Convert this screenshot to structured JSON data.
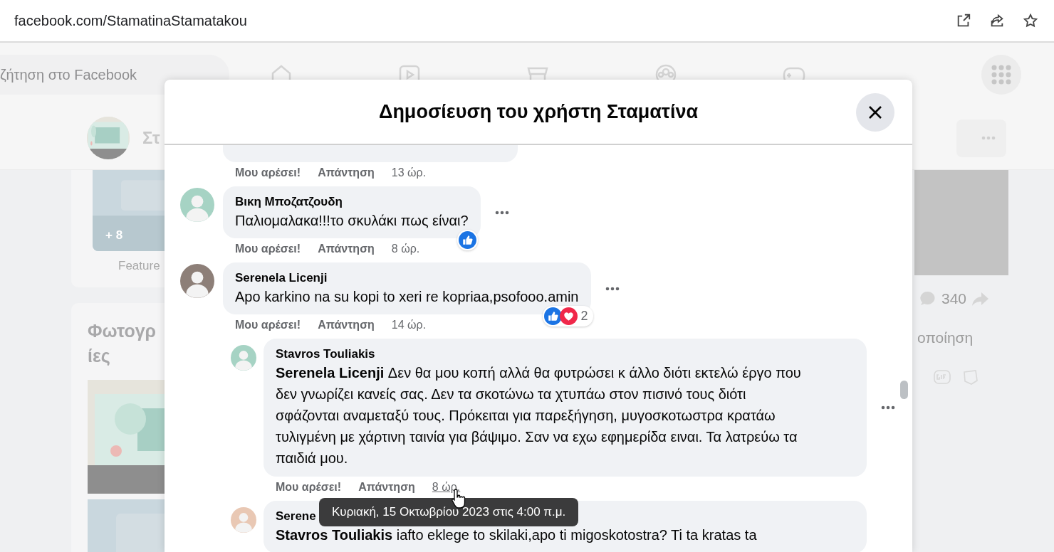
{
  "browser": {
    "url": "facebook.com/StamatinaStamatakou"
  },
  "background": {
    "search": {
      "placeholder": "ζήτηση στο Facebook"
    },
    "profile_name": "Στ",
    "photo_count": "+ 8",
    "featured_label": "Feature",
    "photos_heading": [
      "Φωτογρ",
      "ίες"
    ],
    "share_count": "340",
    "action_label": "οποίηση"
  },
  "modal": {
    "title": "Δημοσίευση του χρήστη Σταματίνα"
  },
  "comments": [
    {
      "kind": "partial",
      "reply": false,
      "actions": {
        "like": "Μου αρέσει!",
        "reply": "Απάντηση",
        "time": "13 ώρ.",
        "underlined": false
      }
    },
    {
      "kind": "comment",
      "reply": false,
      "author": "Βικη Μποζατζουδη",
      "text": "Παλιομαλακα!!!το σκυλάκι πως είναι?",
      "reactions": [
        {
          "kind": "like"
        }
      ],
      "actions": {
        "like": "Μου αρέσει!",
        "reply": "Απάντηση",
        "time": "8 ώρ.",
        "underlined": false
      }
    },
    {
      "kind": "comment",
      "reply": false,
      "author": "Serenela Licenji",
      "text": "Apo karkino na su kopi to xeri re kopriaa,psofooo.amin",
      "reactions": [
        {
          "kind": "like"
        },
        {
          "kind": "love"
        }
      ],
      "reaction_count": "2",
      "actions": {
        "like": "Μου αρέσει!",
        "reply": "Απάντηση",
        "time": "14 ώρ.",
        "underlined": false
      }
    },
    {
      "kind": "comment",
      "reply": true,
      "author": "Stavros Touliakis",
      "text": "**Serenela Licenji** Δεν θα μου κοπή αλλά θα φυτρώσει κ άλλο διότι εκτελώ έργο που δεν γνωρίζει κανείς σας. Δεν τα σκοτώνω τα χτυπάω στον πισινό τους διότι σφάζονται αναμεταξύ τους. Πρόκειται για παρεξήγηση, μυγοσκοτωστρα κρατάω τυλιγμένη με χάρτινη ταινία για βάψιμο. Σαν να εχω εφημερίδα ειναι. Τα λατρεύω τα παιδιά μου.",
      "actions": {
        "like": "Μου αρέσει!",
        "reply": "Απάντηση",
        "time": "8 ώρ.",
        "underlined": true
      }
    },
    {
      "kind": "comment",
      "reply": true,
      "author": "Serene",
      "text": "**Stavros Touliakis** iafto eklege to skilaki,apo ti migoskotostra? Ti ta kratas ta"
    }
  ],
  "tooltip": {
    "text": "Κυριακή, 15 Οκτωβρίου 2023 στις 4:00 π.μ."
  }
}
